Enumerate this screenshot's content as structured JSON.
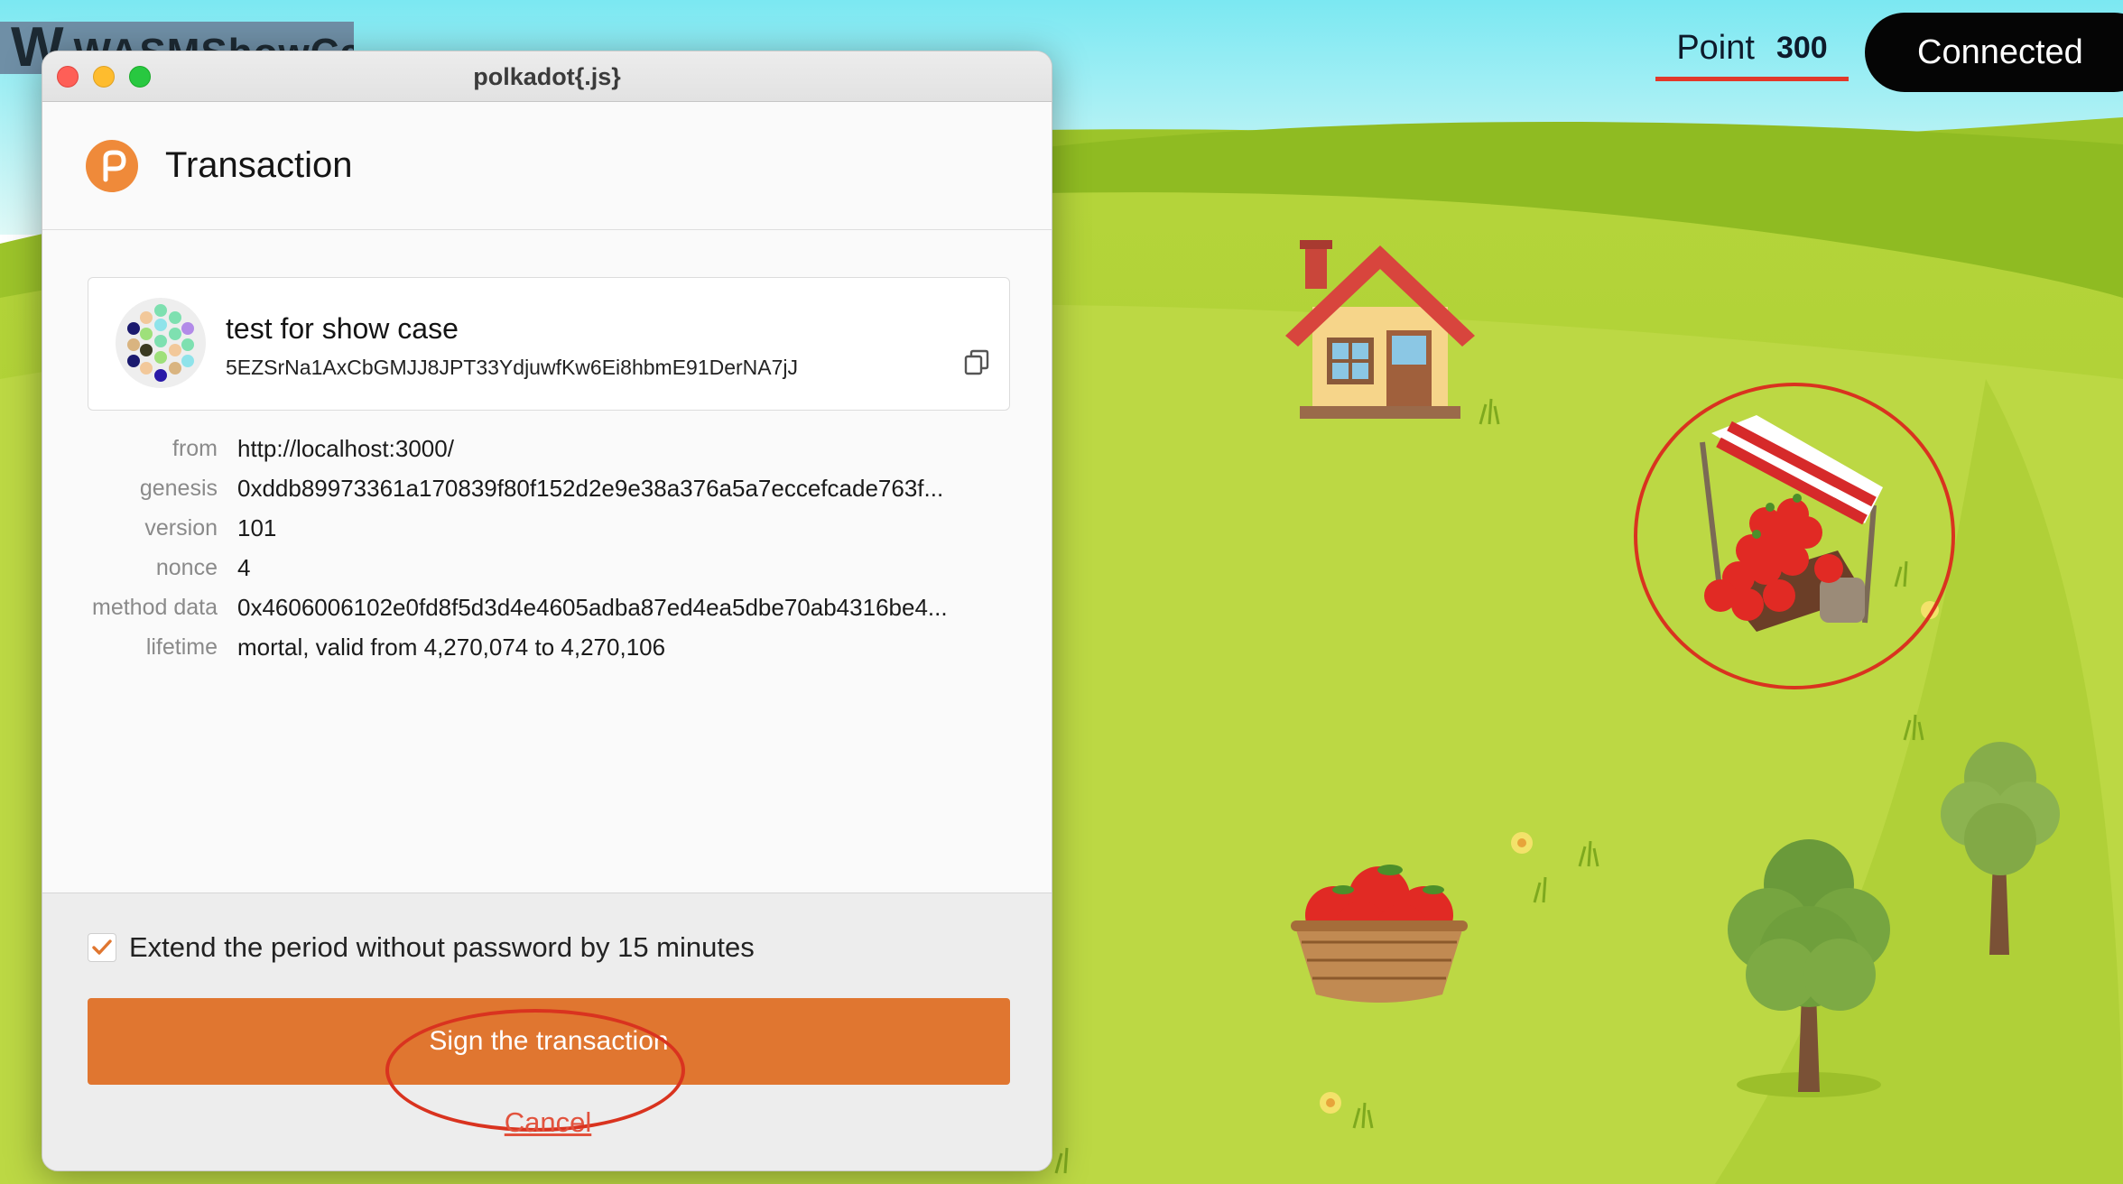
{
  "app": {
    "logo_letter": "W",
    "logo_text": "WASMShowCase"
  },
  "hud": {
    "point_label": "Point",
    "point_value": "300",
    "status": "Connected"
  },
  "game": {
    "sprites": [
      "house-sprite",
      "apple-stand-sprite",
      "apple-basket-sprite",
      "tree-sprite",
      "tree-sprite"
    ],
    "highlight_color": "#d9331f"
  },
  "extension": {
    "window_title": "polkadot{.js}",
    "heading": "Transaction",
    "account": {
      "name": "test for show case",
      "address": "5EZSrNa1AxCbGMJJ8JPT33YdjuwfKw6Ei8hbmE91DerNA7jJ"
    },
    "details": [
      {
        "key": "from",
        "value": "http://localhost:3000/"
      },
      {
        "key": "genesis",
        "value": "0xddb89973361a170839f80f152d2e9e38a376a5a7eccefcade763f..."
      },
      {
        "key": "version",
        "value": "101"
      },
      {
        "key": "nonce",
        "value": "4"
      },
      {
        "key": "method data",
        "value": "0x4606006102e0fd8f5d3d4e4605adba87ed4ea5dbe70ab4316be4..."
      },
      {
        "key": "lifetime",
        "value": "mortal, valid from 4,270,074 to 4,270,106"
      }
    ],
    "extend_label": "Extend the period without password by 15 minutes",
    "extend_checked": true,
    "sign_button": "Sign the transaction",
    "cancel_link": "Cancel",
    "accent_color": "#e07630"
  }
}
